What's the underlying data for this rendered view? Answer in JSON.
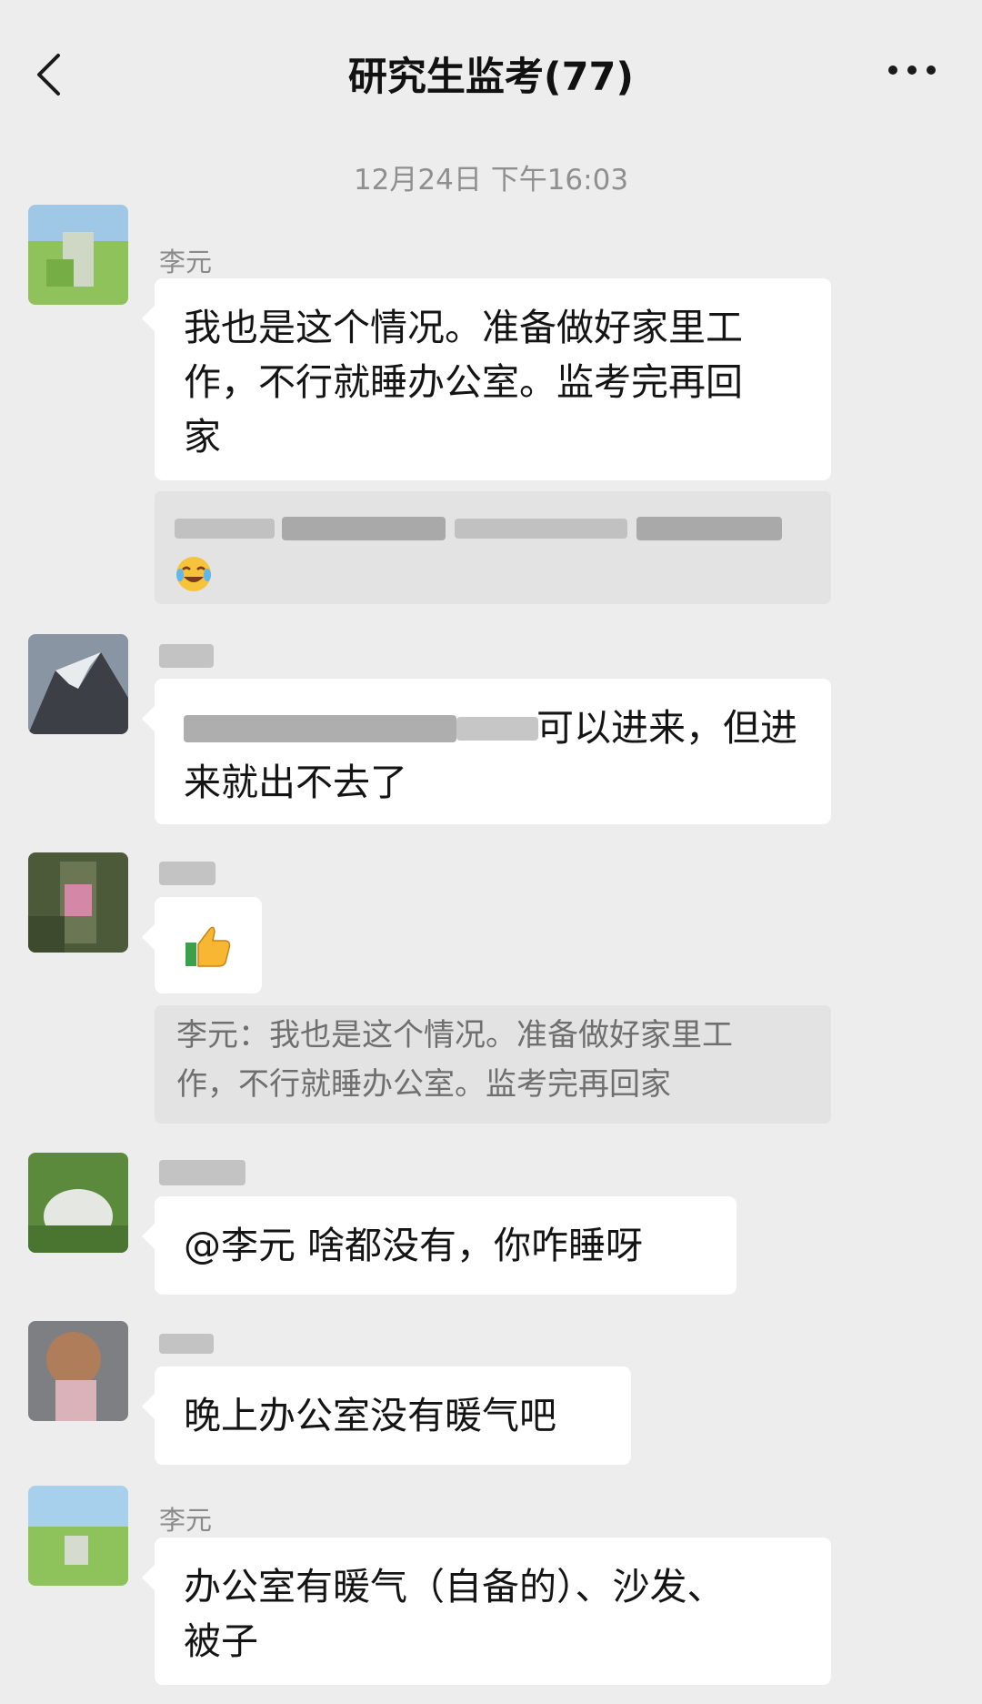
{
  "header": {
    "title": "研究生监考(77)",
    "back_icon": "chevron-left-icon",
    "more_icon": "more-dots-icon"
  },
  "timestamp": "12月24日 下午16:03",
  "messages": [
    {
      "sender": "李元",
      "lines": [
        "我也是这个情况。准备做好家里工",
        "作，不行就睡办公室。监考完再回",
        "家"
      ],
      "quote_emoji": "laughing-crying-emoji"
    },
    {
      "sender": "",
      "text_visible": "可以进来，但进",
      "line2": "来就出不去了"
    },
    {
      "sender": "",
      "emoji": "thumbs-up-emoji",
      "quote_lines": [
        "李元：我也是这个情况。准备做好家里工",
        "作，不行就睡办公室。监考完再回家"
      ]
    },
    {
      "sender": "",
      "text": "@李元  啥都没有，你咋睡呀"
    },
    {
      "sender": "",
      "text": "晚上办公室没有暖气吧"
    },
    {
      "sender": "李元",
      "lines": [
        "办公室有暖气（自备的）、沙发、",
        "被子"
      ]
    }
  ]
}
